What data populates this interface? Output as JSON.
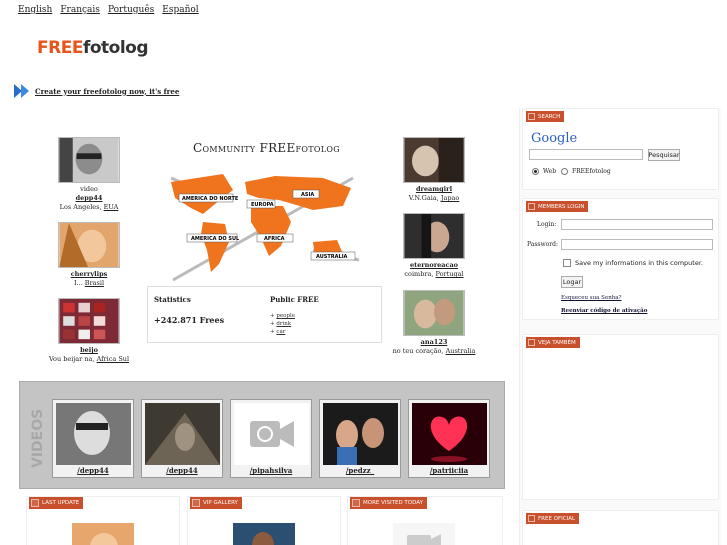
{
  "languages": [
    "English",
    "Français",
    "Português",
    "Español"
  ],
  "logo": {
    "free": "FREE",
    "rest": "fotolog"
  },
  "create_link": "Create your freefotolog now, it's free",
  "community_title": "Community FREEfotolog",
  "map_labels": [
    "AMERICA DO NORTE",
    "EUROPA",
    "ASIA",
    "AMERICA DO SUL",
    "AFRICA",
    "AUSTRALIA"
  ],
  "left_profiles": [
    {
      "label": "video",
      "user": "depp44",
      "loc_text": "Los Angeles,",
      "loc_link": "EUA"
    },
    {
      "label": "",
      "user": "cherrylips",
      "loc_text": "I...",
      "loc_link": "Brasil"
    },
    {
      "label": "",
      "user": "beijo",
      "loc_text": "Vou beijar na,",
      "loc_link": "Africa Sul"
    }
  ],
  "right_profiles": [
    {
      "user": "dreamgirl",
      "loc_text": "V.N.Gaia,",
      "loc_link": "Japao"
    },
    {
      "user": "eternoreacao",
      "loc_text": "coimbra,",
      "loc_link": "Portugal"
    },
    {
      "user": "ana123",
      "loc_text": "no teu coração,",
      "loc_link": "Australia"
    }
  ],
  "stats": {
    "heading": "Statistics",
    "value": "+242.871 Frees",
    "public_heading": "Public FREE",
    "public_links": [
      "people",
      "drink",
      "car"
    ]
  },
  "videos": {
    "label": "VIDEOS",
    "items": [
      "/depp44",
      "/depp44",
      "/pipahsilva",
      "/pedzz_",
      "/patriiciia"
    ]
  },
  "bottom_panels": [
    "LAST UPDATE",
    "VIP GALLERY",
    "MORE VISITED TODAY"
  ],
  "sidebar": {
    "search": {
      "tag": "SEARCH",
      "google": "Google",
      "button": "Pesquisar",
      "opt_web": "Web",
      "opt_site": "FREEfotolog"
    },
    "login": {
      "tag": "MEMBERS LOGIN",
      "login_label": "Login:",
      "password_label": "Password:",
      "remember": "Save my informations in this computer.",
      "button": "Logar",
      "forgot": "Esqueceu sua Senha?",
      "resend": "Reenviar código de ativação"
    },
    "see_also": {
      "tag": "VEJA TAMBÉM"
    },
    "official": {
      "tag": "FREE OFICIAL"
    }
  },
  "colors": {
    "accent": "#e8551c",
    "tag": "#c8502d",
    "map": "#f0731e"
  }
}
